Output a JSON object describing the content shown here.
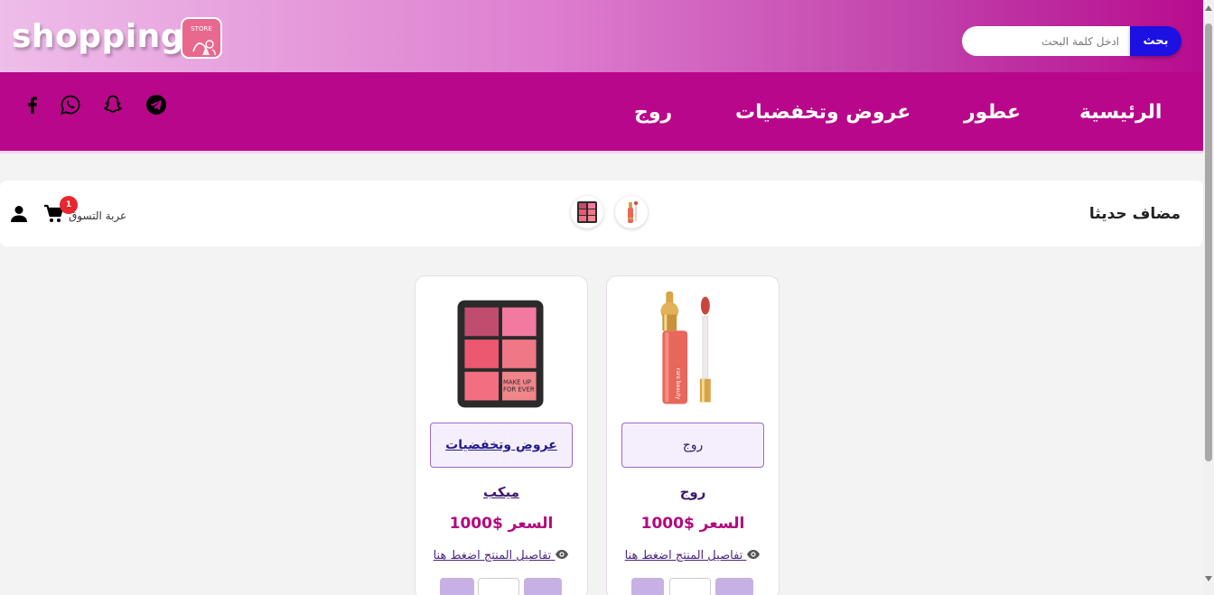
{
  "header": {
    "logo_text": "shopping",
    "logo_badge_text": "STORE",
    "search": {
      "placeholder": "ادخل كلمة البحث",
      "button_label": "بحث"
    }
  },
  "nav": {
    "items": [
      {
        "label": "الرئيسية"
      },
      {
        "label": "عطور"
      },
      {
        "label": "عروض وتخفضيات"
      },
      {
        "label": "روج"
      }
    ],
    "social_icons": [
      "telegram-icon",
      "snapchat-icon",
      "whatsapp-icon",
      "facebook-icon"
    ]
  },
  "recent": {
    "title": "مضاف حديثا",
    "thumbnails": [
      "lip-gloss",
      "blush-palette"
    ],
    "cart_label": "عربة التسوق",
    "cart_count": "1"
  },
  "products": [
    {
      "image": "lip-gloss",
      "category": "روج",
      "name": "روج",
      "price": "السعر $1000",
      "details": "تفاصيل المنتج اضغط هنا"
    },
    {
      "image": "blush-palette",
      "category": "عروض وتخفضيات",
      "name": "ميكب",
      "price": "السعر $1000",
      "details": "تفاصيل المنتج اضغط هنا"
    }
  ],
  "colors": {
    "nav_bg": "#b8078a",
    "price": "#b3087f",
    "search_button": "#1c10e3",
    "badge": "#e8262f"
  }
}
